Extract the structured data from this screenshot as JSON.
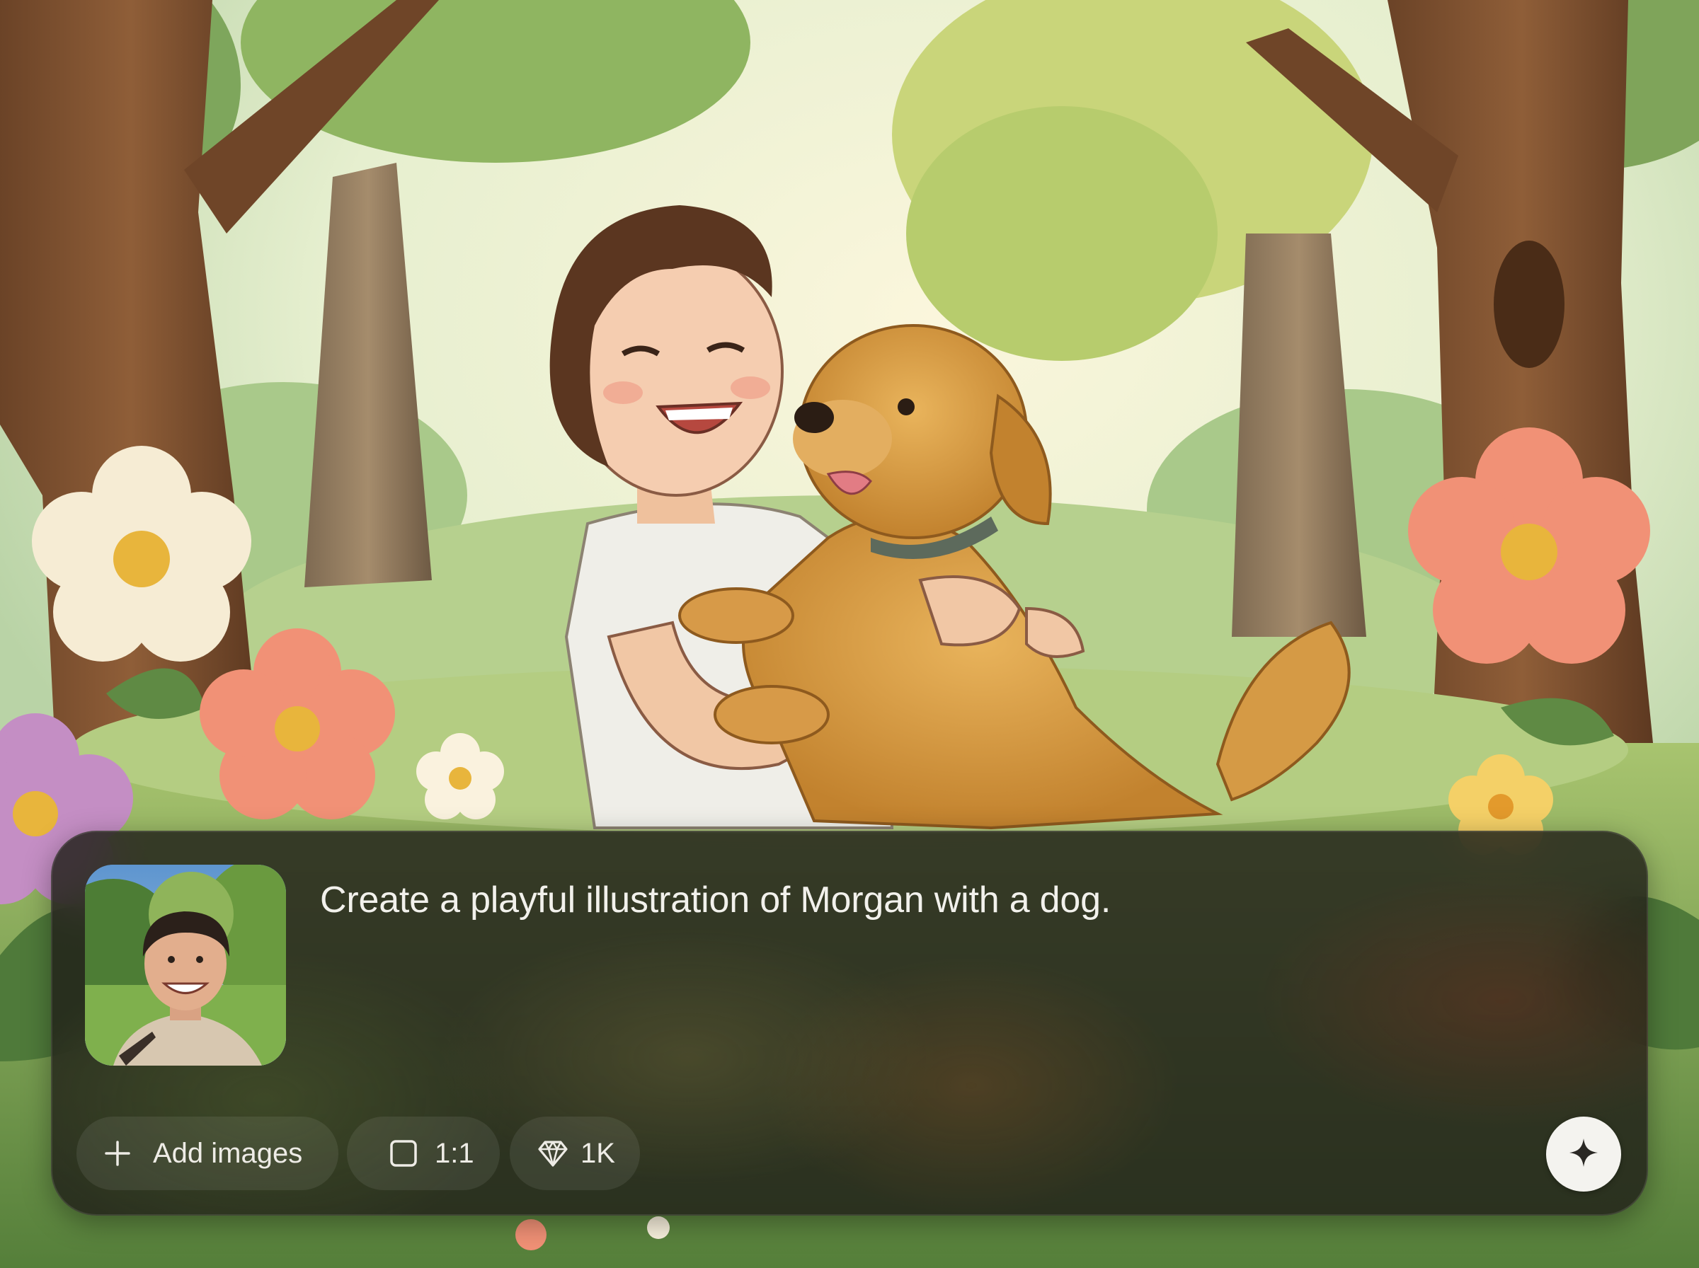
{
  "composer": {
    "prompt": "Create a playful illustration of Morgan with a dog.",
    "reference_image_alt": "Photo of Morgan smiling in a park",
    "add_images_label": "Add images",
    "aspect_ratio_label": "1:1",
    "resolution_label": "1K",
    "generate_icon": "sparkle-icon"
  },
  "icons": {
    "add": "plus-icon",
    "aspect": "square-icon",
    "resolution": "diamond-icon"
  },
  "colors": {
    "panel": "#201e18",
    "text": "#f2f1ec",
    "button": "#f4f3ef"
  }
}
